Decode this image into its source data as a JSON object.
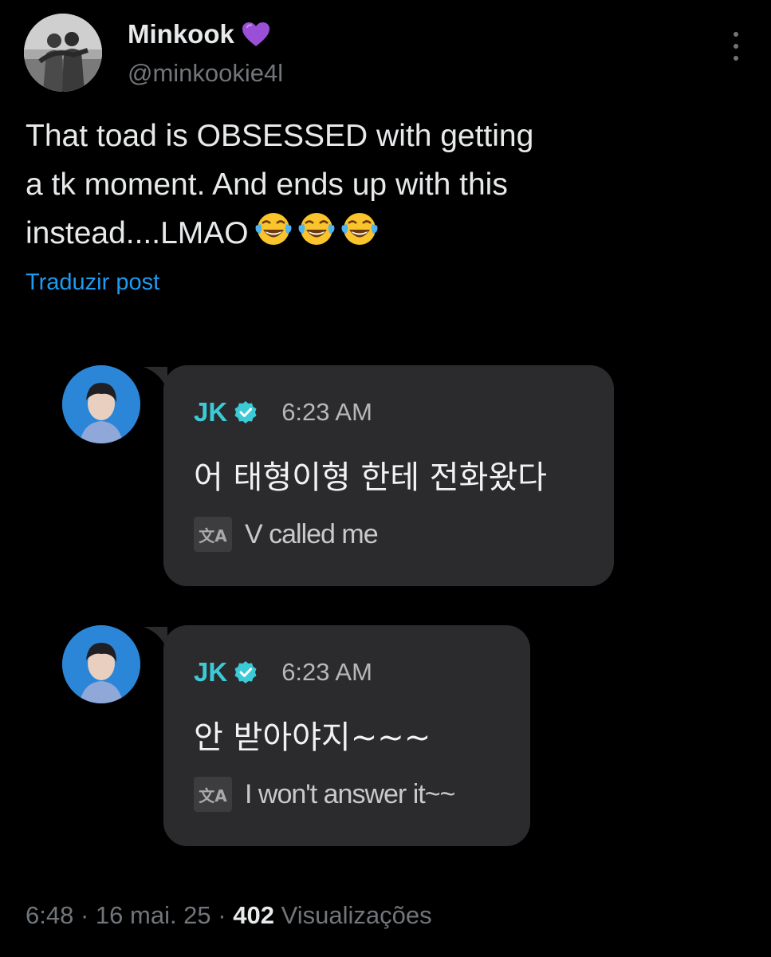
{
  "author": {
    "display_name": "Minkook",
    "handle": "@minkookie4l",
    "badge_emoji": "purple-heart-icon",
    "accent_color": "#9b4fd6"
  },
  "tweet": {
    "lines": [
      "That toad is OBSESSED with getting",
      "a tk moment. And ends up with this",
      "instead....LMAO"
    ],
    "emoji_icons": [
      "tears-of-joy-icon",
      "tears-of-joy-icon",
      "tears-of-joy-icon"
    ],
    "translate_label": "Traduzir post"
  },
  "chat": {
    "messages": [
      {
        "sender": "JK",
        "time": "6:23 AM",
        "text": "어 태형이형 한테 전화왔다",
        "translate_icon_label": "文A",
        "translation": "V called me"
      },
      {
        "sender": "JK",
        "time": "6:23 AM",
        "text": "안 받아야지~~~",
        "translate_icon_label": "文A",
        "translation": "I won't answer it~~"
      }
    ],
    "sender_color": "#3ccbd6"
  },
  "meta": {
    "time": "6:48",
    "sep1": " · ",
    "date": "16 mai. 25",
    "sep2": " · ",
    "views_count": "402",
    "views_label": " Visualizações"
  }
}
